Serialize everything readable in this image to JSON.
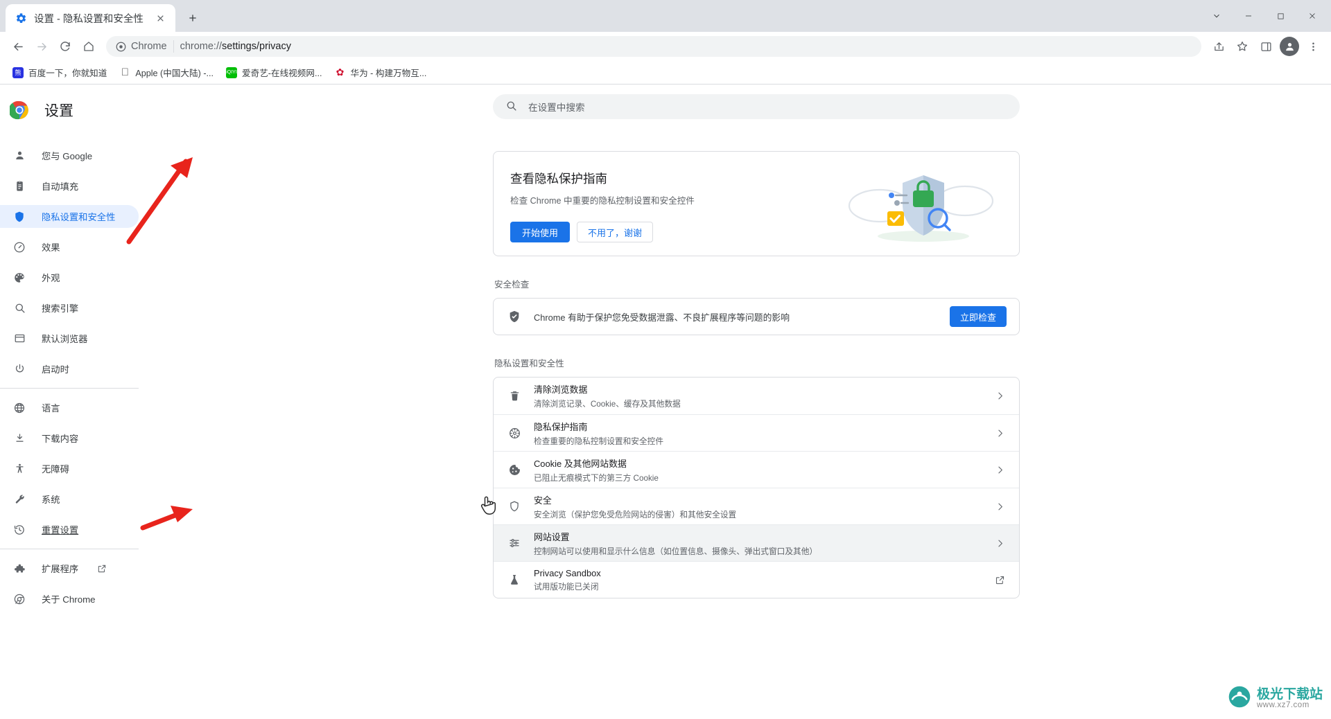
{
  "window": {
    "tab": {
      "title": "设置 - 隐私设置和安全性",
      "favicon": "gear-icon",
      "close": "×"
    },
    "new_tab": "+",
    "controls": {
      "minimize_all": "⌄",
      "minimize": "—",
      "maximize": "□",
      "close": "✕"
    }
  },
  "toolbar": {
    "back": "back-icon",
    "forward": "forward-icon",
    "reload": "reload-icon",
    "home": "home-icon",
    "omnibox": {
      "chip": "Chrome",
      "url_prefix": "chrome://",
      "url_bold": "settings/privacy",
      "full": "chrome://settings/privacy"
    },
    "share": "share-icon",
    "bookmark": "star-icon",
    "sidepanel": "side-panel-icon",
    "profile": "avatar-icon",
    "menu": "three-dot-menu-icon"
  },
  "bookmarks": [
    {
      "label": "百度一下，你就知道",
      "icon": "baidu-icon",
      "color": "#2932e1"
    },
    {
      "label": "Apple (中国大陆) -...",
      "icon": "apple-icon",
      "color": "#555555"
    },
    {
      "label": "爱奇艺-在线视频网...",
      "icon": "iqiyi-icon",
      "color": "#00be06"
    },
    {
      "label": "华为 - 构建万物互...",
      "icon": "huawei-icon",
      "color": "#cf0a2c"
    }
  ],
  "sidebar": {
    "brand": "设置",
    "brand_logo": "chrome-logo-icon",
    "items": [
      {
        "label": "您与 Google",
        "icon": "person-icon",
        "active": false
      },
      {
        "label": "自动填充",
        "icon": "clipboard-icon",
        "active": false
      },
      {
        "label": "隐私设置和安全性",
        "icon": "shield-icon",
        "active": true
      },
      {
        "label": "效果",
        "icon": "speedometer-icon",
        "active": false
      },
      {
        "label": "外观",
        "icon": "palette-icon",
        "active": false
      },
      {
        "label": "搜索引擎",
        "icon": "search-icon",
        "active": false
      },
      {
        "label": "默认浏览器",
        "icon": "browser-window-icon",
        "active": false
      },
      {
        "label": "启动时",
        "icon": "power-icon",
        "active": false
      }
    ],
    "items2": [
      {
        "label": "语言",
        "icon": "globe-icon"
      },
      {
        "label": "下载内容",
        "icon": "download-icon"
      },
      {
        "label": "无障碍",
        "icon": "accessibility-icon"
      },
      {
        "label": "系统",
        "icon": "wrench-icon"
      },
      {
        "label": "重置设置",
        "icon": "history-icon",
        "underline": true
      }
    ],
    "items3": [
      {
        "label": "扩展程序",
        "icon": "puzzle-icon",
        "external": true
      },
      {
        "label": "关于 Chrome",
        "icon": "chrome-outline-icon",
        "external": false
      }
    ]
  },
  "search": {
    "placeholder": "在设置中搜索",
    "value": "",
    "icon": "search-icon"
  },
  "privacy_guide_card": {
    "title": "查看隐私保护指南",
    "subtitle": "检查 Chrome 中重要的隐私控制设置和安全控件",
    "primary_button": "开始使用",
    "secondary_button": "不用了，谢谢",
    "illustration": "privacy-shield-illustration"
  },
  "safety_check": {
    "section_title": "安全检查",
    "icon": "shield-check-icon",
    "text": "Chrome 有助于保护您免受数据泄露、不良扩展程序等问题的影响",
    "button": "立即检查"
  },
  "privacy_section": {
    "section_title": "隐私设置和安全性",
    "rows": [
      {
        "title": "清除浏览数据",
        "subtitle": "清除浏览记录、Cookie、缓存及其他数据",
        "icon": "trash-icon",
        "end_icon": "chevron-right-icon",
        "hover": false
      },
      {
        "title": "隐私保护指南",
        "subtitle": "检查重要的隐私控制设置和安全控件",
        "icon": "privacy-guide-icon",
        "end_icon": "chevron-right-icon",
        "hover": false
      },
      {
        "title": "Cookie 及其他网站数据",
        "subtitle": "已阻止无痕模式下的第三方 Cookie",
        "icon": "cookie-icon",
        "end_icon": "chevron-right-icon",
        "hover": false
      },
      {
        "title": "安全",
        "subtitle": "安全浏览（保护您免受危险网站的侵害）和其他安全设置",
        "icon": "shield-icon",
        "end_icon": "chevron-right-icon",
        "hover": false
      },
      {
        "title": "网站设置",
        "subtitle": "控制网站可以使用和显示什么信息（如位置信息、摄像头、弹出式窗口及其他）",
        "icon": "sliders-icon",
        "end_icon": "chevron-right-icon",
        "hover": true
      },
      {
        "title": "Privacy Sandbox",
        "subtitle": "试用版功能已关闭",
        "icon": "flask-icon",
        "end_icon": "external-link-icon",
        "hover": false
      }
    ]
  },
  "annotations": {
    "arrow_color": "#e8241c",
    "arrow1": "red-arrow-pointing-to-privacy-sidebar-item",
    "arrow2": "red-arrow-pointing-to-site-settings-row",
    "cursor": "hand-pointer-cursor"
  },
  "watermark": {
    "main": "极光下载站",
    "sub": "www.xz7.com",
    "icon": "aurora-icon"
  }
}
